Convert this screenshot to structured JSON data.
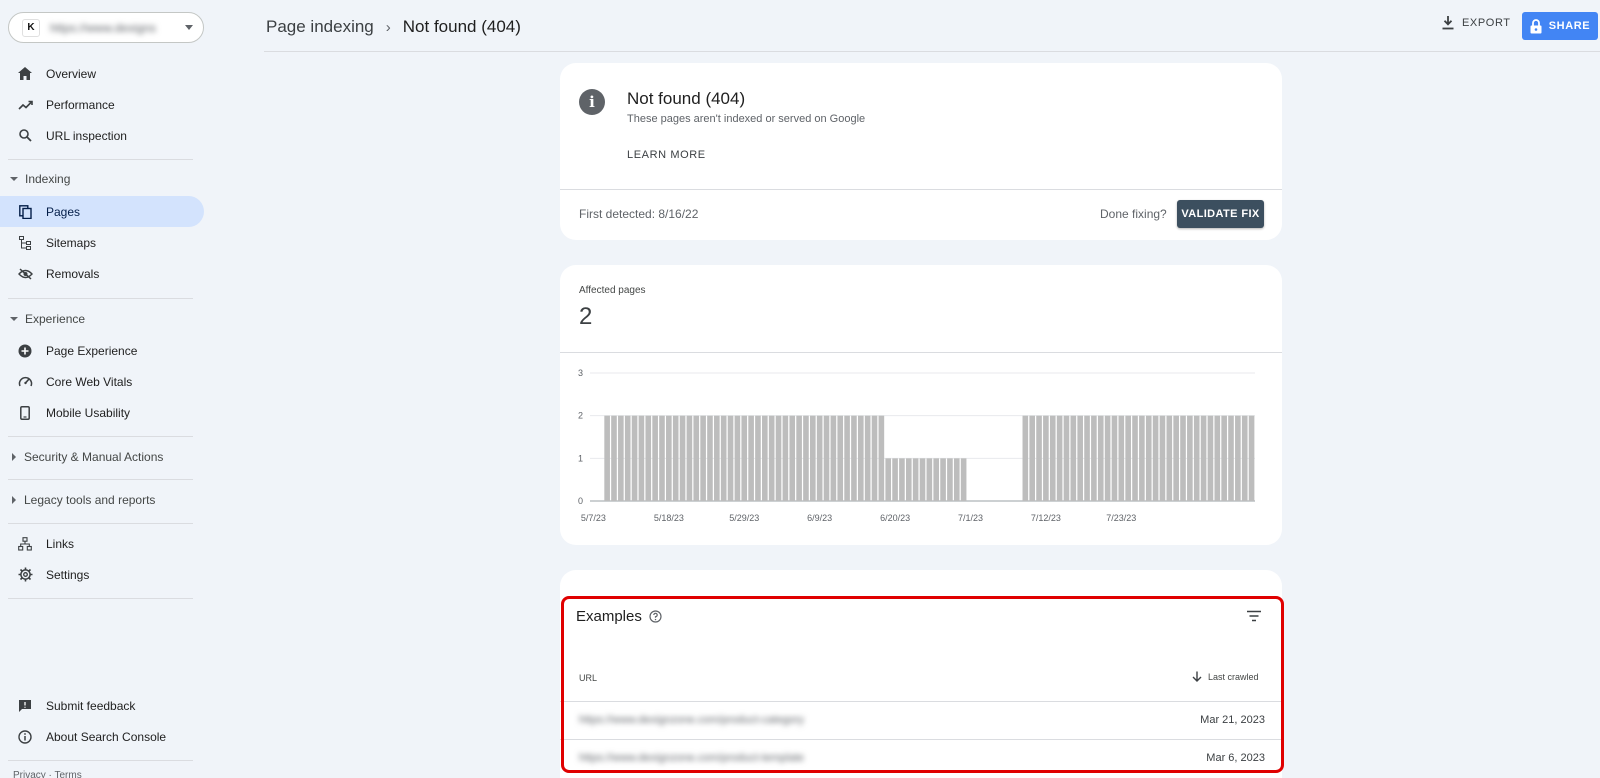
{
  "property": {
    "icon_letter": "K",
    "name": "https://www.dexigns"
  },
  "nav": {
    "overview": "Overview",
    "performance": "Performance",
    "url_inspection": "URL inspection",
    "indexing_section": "Indexing",
    "pages": "Pages",
    "sitemaps": "Sitemaps",
    "removals": "Removals",
    "experience_section": "Experience",
    "page_experience": "Page Experience",
    "core_web_vitals": "Core Web Vitals",
    "mobile_usability": "Mobile Usability",
    "security_section": "Security & Manual Actions",
    "legacy_section": "Legacy tools and reports",
    "links": "Links",
    "settings": "Settings",
    "submit_feedback": "Submit feedback",
    "about": "About Search Console"
  },
  "footer": {
    "links": "Privacy · Terms"
  },
  "breadcrumb": {
    "parent": "Page indexing",
    "separator": "›",
    "current": "Not found (404)"
  },
  "toolbar": {
    "export_label": "EXPORT",
    "share_label": "SHARE"
  },
  "issue": {
    "title": "Not found (404)",
    "description": "These pages aren't indexed or served on Google",
    "learn_more": "LEARN MORE",
    "first_detected": "First detected: 8/16/22",
    "done_fixing": "Done fixing?",
    "validate_label": "VALIDATE FIX"
  },
  "affected": {
    "label": "Affected pages",
    "count": "2"
  },
  "chart_data": {
    "type": "bar",
    "color": "#bdbdbd",
    "ylim": [
      0,
      3
    ],
    "yticks": [
      0,
      1,
      2,
      3
    ],
    "grid": true,
    "xtick_labels": [
      "5/7/23",
      "5/18/23",
      "5/29/23",
      "6/9/23",
      "6/20/23",
      "7/1/23",
      "7/12/23",
      "7/23/23"
    ],
    "values": [
      0,
      0,
      2,
      2,
      2,
      2,
      2,
      2,
      2,
      2,
      2,
      2,
      2,
      2,
      2,
      2,
      2,
      2,
      2,
      2,
      2,
      2,
      2,
      2,
      2,
      2,
      2,
      2,
      2,
      2,
      2,
      2,
      2,
      2,
      2,
      2,
      2,
      2,
      2,
      2,
      2,
      2,
      2,
      1,
      1,
      1,
      1,
      1,
      1,
      1,
      1,
      1,
      1,
      1,
      1,
      0,
      0,
      0,
      0,
      0,
      0,
      0,
      0,
      2,
      2,
      2,
      2,
      2,
      2,
      2,
      2,
      2,
      2,
      2,
      2,
      2,
      2,
      2,
      2,
      2,
      2,
      2,
      2,
      2,
      2,
      2,
      2,
      2,
      2,
      2,
      2,
      2,
      2,
      2,
      2,
      2,
      2
    ]
  },
  "examples": {
    "title": "Examples",
    "col_url": "URL",
    "col_last_crawled": "Last crawled",
    "rows": [
      {
        "url": "https://www.dexignzone.com/product-category",
        "date": "Mar 21, 2023"
      },
      {
        "url": "https://www.dexignzone.com/product-template",
        "date": "Mar 6, 2023"
      }
    ]
  }
}
